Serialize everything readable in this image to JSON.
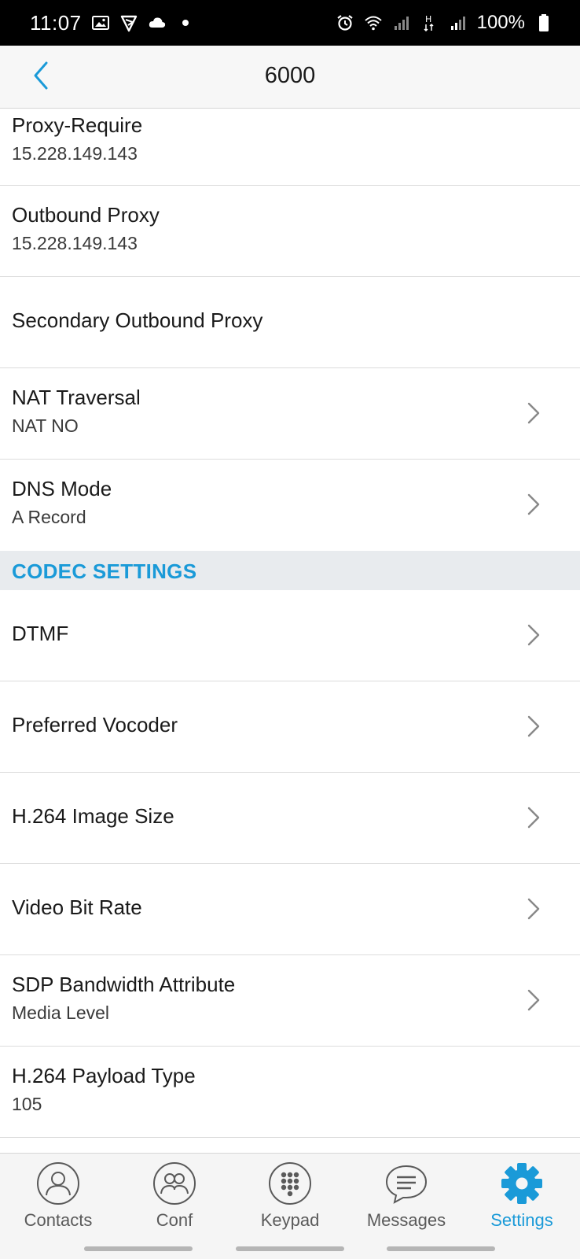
{
  "status_bar": {
    "time": "11:07",
    "battery_pct": "100%",
    "icons": [
      "image-icon",
      "app-notification-icon",
      "cloud-icon",
      "dot-icon",
      "alarm-icon",
      "wifi-icon",
      "signal-icon",
      "hd-icon",
      "signal-icon",
      "battery-icon"
    ]
  },
  "header": {
    "title": "6000",
    "back_icon": "chevron-left-icon"
  },
  "rows_top": [
    {
      "label": "Proxy-Require",
      "value": "15.228.149.143",
      "chevron": false
    },
    {
      "label": "Outbound Proxy",
      "value": "15.228.149.143",
      "chevron": false
    },
    {
      "label": "Secondary Outbound Proxy",
      "value": "",
      "chevron": false
    },
    {
      "label": "NAT Traversal",
      "value": "NAT NO",
      "chevron": true
    },
    {
      "label": "DNS Mode",
      "value": "A Record",
      "chevron": true
    }
  ],
  "section": {
    "title": "CODEC SETTINGS"
  },
  "rows_codec": [
    {
      "label": "DTMF",
      "value": "",
      "chevron": true
    },
    {
      "label": "Preferred Vocoder",
      "value": "",
      "chevron": true
    },
    {
      "label": "H.264 Image Size",
      "value": "",
      "chevron": true
    },
    {
      "label": "Video Bit Rate",
      "value": "",
      "chevron": true
    },
    {
      "label": "SDP Bandwidth Attribute",
      "value": "Media Level",
      "chevron": true
    },
    {
      "label": "H.264 Payload Type",
      "value": "105",
      "chevron": false
    }
  ],
  "bottom_nav": [
    {
      "label": "Contacts",
      "icon": "contacts-icon",
      "active": false
    },
    {
      "label": "Conf",
      "icon": "conference-icon",
      "active": false
    },
    {
      "label": "Keypad",
      "icon": "keypad-icon",
      "active": false
    },
    {
      "label": "Messages",
      "icon": "messages-icon",
      "active": false
    },
    {
      "label": "Settings",
      "icon": "settings-gear-icon",
      "active": true
    }
  ],
  "colors": {
    "accent": "#1a9ad8",
    "section_bg": "#e8ebee",
    "divider": "#dcdcdc",
    "nav_inactive": "#5a5a5a"
  }
}
